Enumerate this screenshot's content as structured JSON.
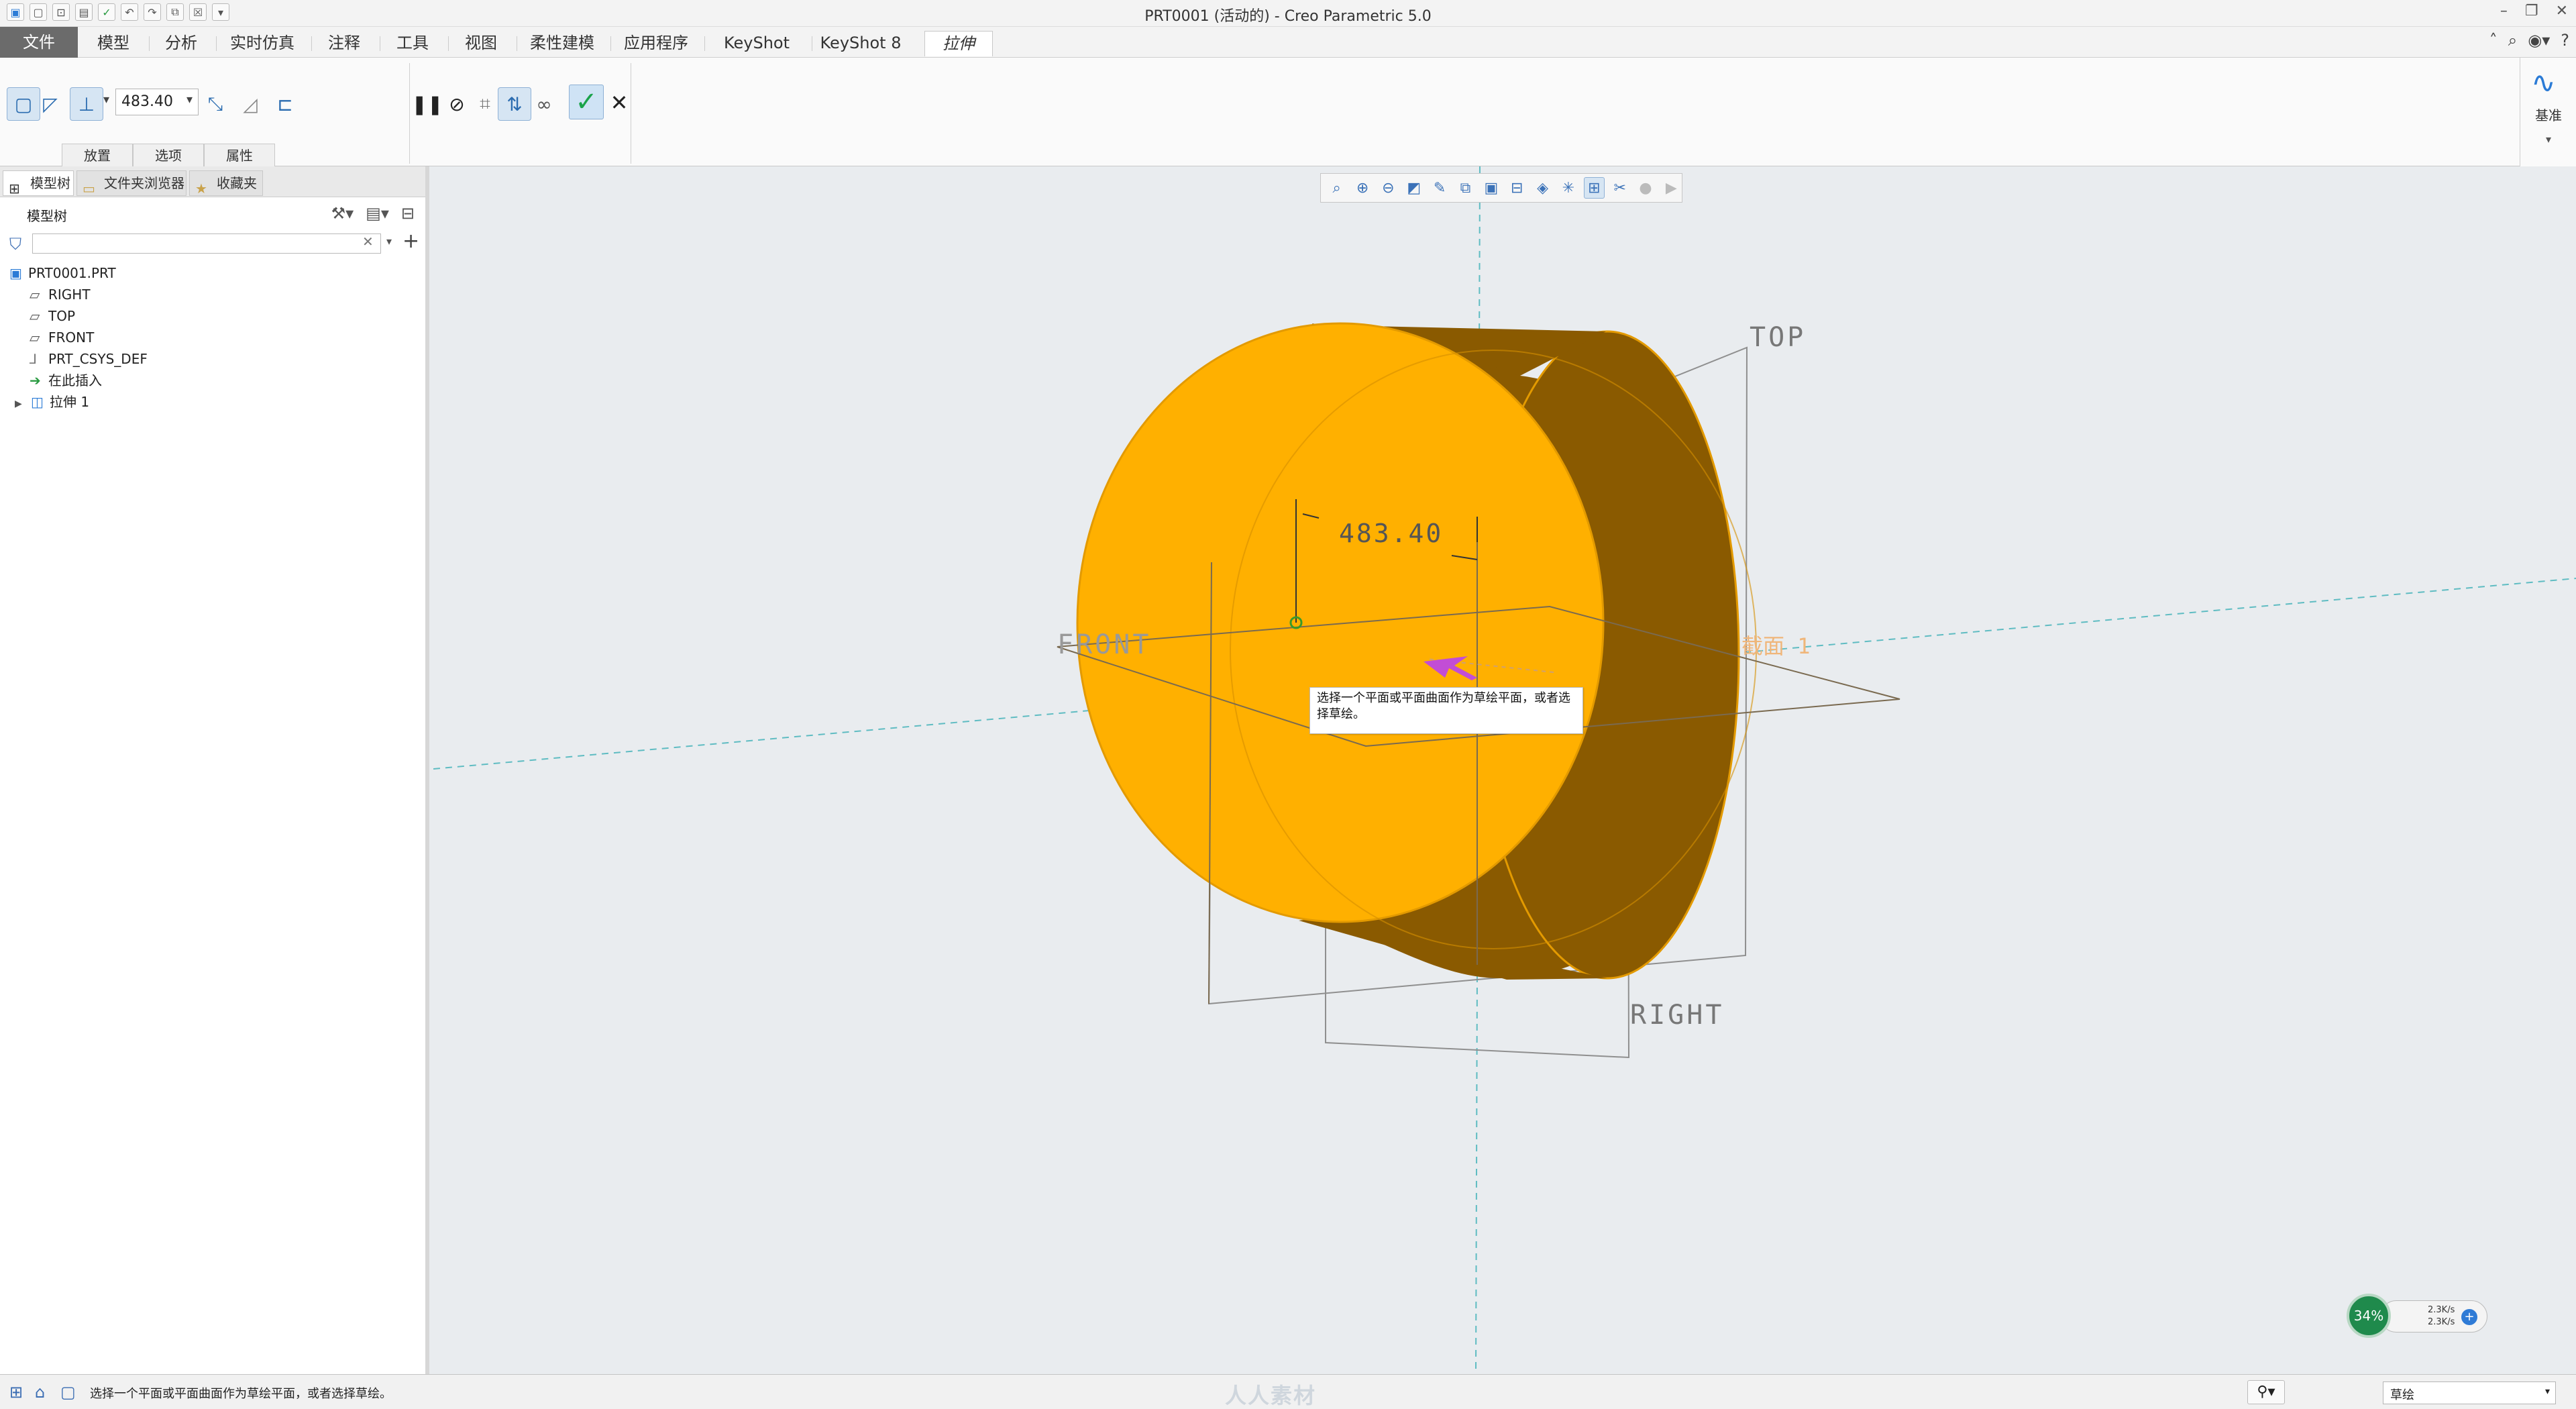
{
  "window": {
    "title": "PRT0001 (活动的) - Creo Parametric 5.0"
  },
  "quick_access": {
    "icons": [
      "new-icon",
      "open-icon",
      "save-icon",
      "undo-icon",
      "redo-icon",
      "regenerate-icon",
      "windows-icon",
      "close-window-icon",
      "customize-icon"
    ]
  },
  "menu_tabs": [
    {
      "label": "文件"
    },
    {
      "label": "模型"
    },
    {
      "label": "分析"
    },
    {
      "label": "实时仿真"
    },
    {
      "label": "注释"
    },
    {
      "label": "工具"
    },
    {
      "label": "视图"
    },
    {
      "label": "柔性建模"
    },
    {
      "label": "应用程序"
    },
    {
      "label": "KeyShot"
    },
    {
      "label": "KeyShot 8"
    },
    {
      "label": "拉伸"
    }
  ],
  "ribbon": {
    "depth_value": "483.40",
    "subtabs": [
      {
        "label": "放置"
      },
      {
        "label": "选项"
      },
      {
        "label": "属性"
      }
    ],
    "datum_label": "基准"
  },
  "panel": {
    "tabs": [
      {
        "label": "模型树"
      },
      {
        "label": "文件夹浏览器"
      },
      {
        "label": "收藏夹"
      }
    ],
    "tree_title": "模型树",
    "filter_placeholder": "",
    "nodes": [
      {
        "label": "PRT0001.PRT",
        "icon": "part-icon"
      },
      {
        "label": "RIGHT",
        "icon": "datum-plane-icon"
      },
      {
        "label": "TOP",
        "icon": "datum-plane-icon"
      },
      {
        "label": "FRONT",
        "icon": "datum-plane-icon"
      },
      {
        "label": "PRT_CSYS_DEF",
        "icon": "csys-icon"
      },
      {
        "label": "在此插入",
        "icon": "insert-here-icon"
      },
      {
        "label": "拉伸 1",
        "icon": "extrude-icon"
      }
    ]
  },
  "viewport": {
    "dimension_text": "483.40",
    "plane_labels": {
      "top": "TOP",
      "front": "FRONT",
      "right": "RIGHT"
    },
    "sketch_label": "截面 1",
    "tooltip": "选择一个平面或平面曲面作为草绘平面，或者选择草绘。",
    "colors": {
      "cylinder_face": "#ffb000",
      "cylinder_side": "#8a5a00",
      "outline": "#e39a00"
    }
  },
  "net_widget": {
    "percent": "34%",
    "upload": "2.3K/s",
    "download": "2.3K/s"
  },
  "status": {
    "message": "选择一个平面或平面曲面作为草绘平面，或者选择草绘。",
    "watermark": "人人素材",
    "selection_filter": "草绘"
  }
}
